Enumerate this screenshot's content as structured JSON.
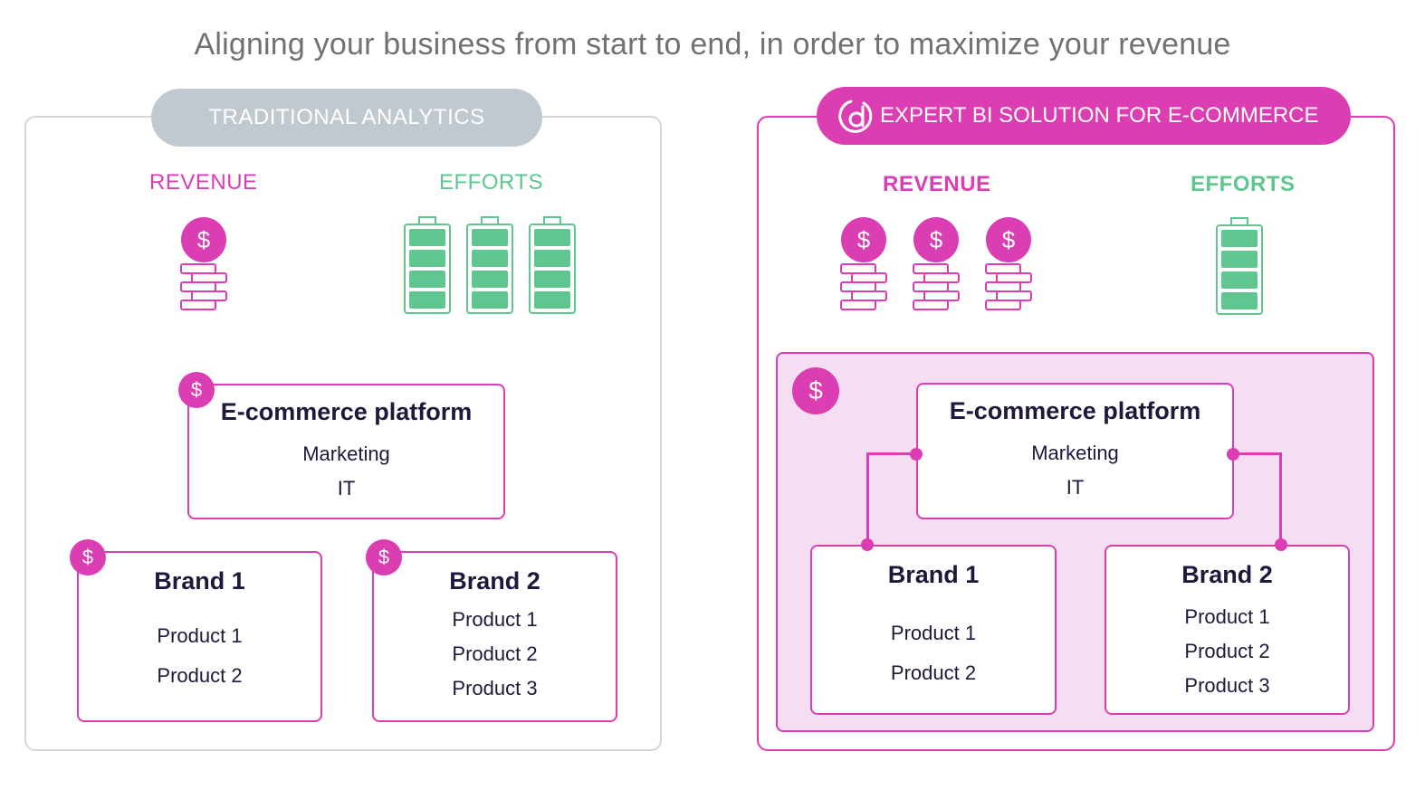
{
  "headline": "Aligning your business from start to end, in order to maximize your revenue",
  "colors": {
    "pink": "#db3db3",
    "green": "#5ec68e",
    "gray_pill": "#c1c9d0",
    "light_pink": "#f6def2",
    "dark_text": "#1c1a3a"
  },
  "left": {
    "title": "TRADITIONAL ANALYTICS",
    "revenue_label": "REVENUE",
    "efforts_label": "EFFORTS",
    "revenue_coins": 1,
    "effort_batteries": 3,
    "platform": {
      "title": "E-commerce platform",
      "items": [
        "Marketing",
        "IT"
      ],
      "badge": "$"
    },
    "brands": [
      {
        "title": "Brand 1",
        "items": [
          "Product 1",
          "Product 2"
        ],
        "badge": "$"
      },
      {
        "title": "Brand 2",
        "items": [
          "Product 1",
          "Product 2",
          "Product 3"
        ],
        "badge": "$"
      }
    ]
  },
  "right": {
    "title": "EXPERT BI SOLUTION FOR E-COMMERCE",
    "logo_icon": "brand-logo-icon",
    "revenue_label": "REVENUE",
    "efforts_label": "EFFORTS",
    "revenue_coins": 3,
    "effort_batteries": 1,
    "area_badge": "$",
    "platform": {
      "title": "E-commerce platform",
      "items": [
        "Marketing",
        "IT"
      ]
    },
    "brands": [
      {
        "title": "Brand 1",
        "items": [
          "Product 1",
          "Product 2"
        ]
      },
      {
        "title": "Brand 2",
        "items": [
          "Product 1",
          "Product 2",
          "Product 3"
        ]
      }
    ]
  },
  "coin_symbol": "$"
}
